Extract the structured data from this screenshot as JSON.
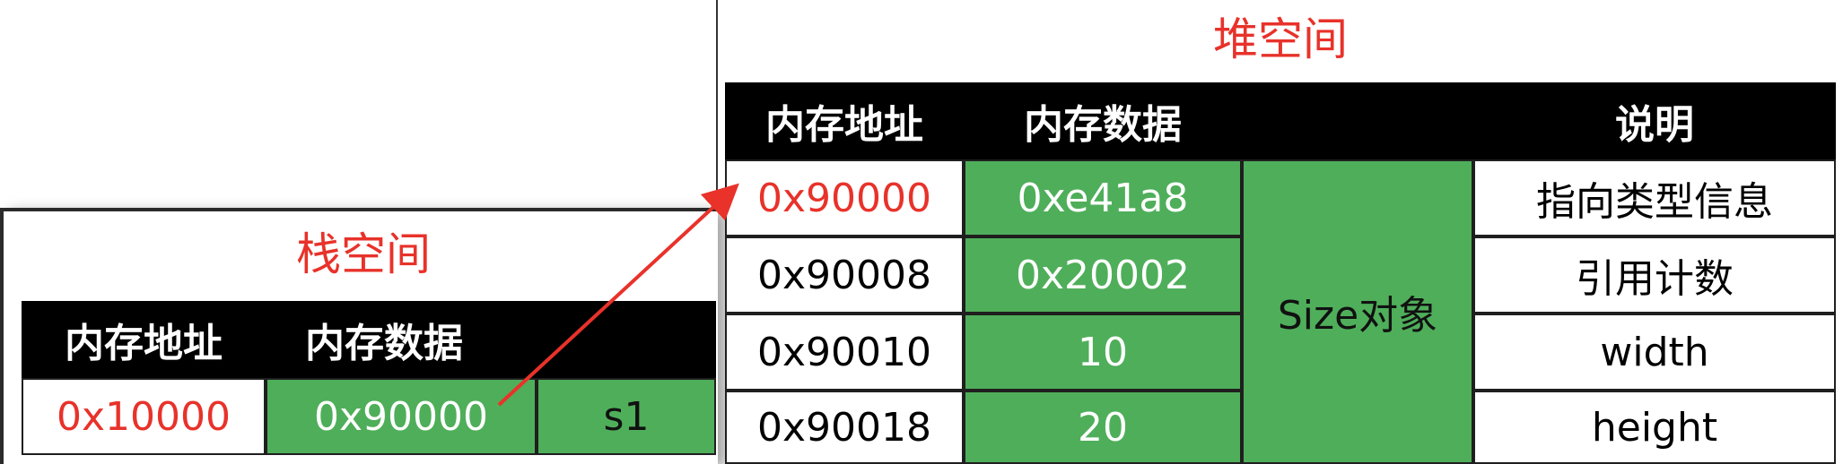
{
  "stack": {
    "title": "栈空间",
    "headers": [
      "内存地址",
      "内存数据"
    ],
    "row": {
      "address": "0x10000",
      "value": "0x90000",
      "label": "s1"
    }
  },
  "heap": {
    "title": "堆空间",
    "headers": [
      "内存地址",
      "内存数据",
      "",
      "说明"
    ],
    "object_label": "Size对象",
    "rows": [
      {
        "address": "0x90000",
        "value": "0xe41a8",
        "note": "指向类型信息"
      },
      {
        "address": "0x90008",
        "value": "0x20002",
        "note": "引用计数"
      },
      {
        "address": "0x90010",
        "value": "10",
        "note": "width"
      },
      {
        "address": "0x90018",
        "value": "20",
        "note": "height"
      }
    ]
  },
  "colors": {
    "accent_red": "#e8322a",
    "cell_green": "#4fae5a",
    "header_black": "#000000",
    "arrow": "#e8322a"
  }
}
